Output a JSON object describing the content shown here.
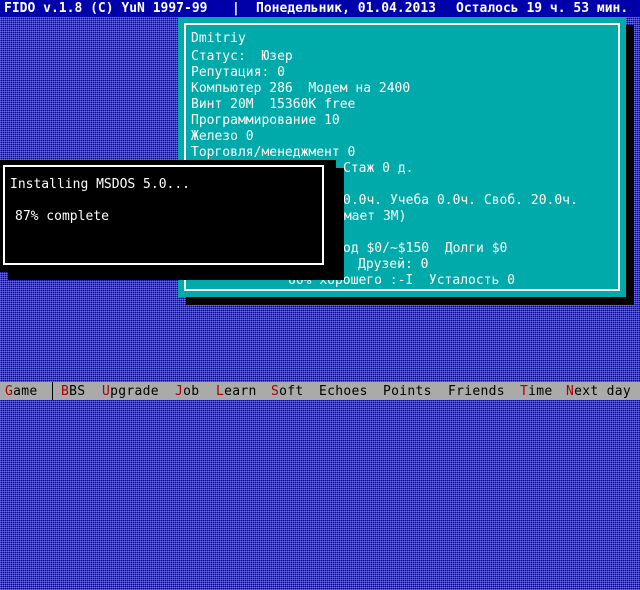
{
  "titlebar": {
    "app": "FIDO v.1.8 (C) YuN 1997-99",
    "separator": "|",
    "date": "Понедельник, 01.04.2013",
    "time_left": "Осталось 19 ч. 53 мин."
  },
  "player": {
    "name": "Dmitriy",
    "status_label": "Статус:",
    "status_value": "Юзер",
    "reputation_label": "Репутация:",
    "reputation_value": "0",
    "computer_label": "Компьютер",
    "computer_value": "286",
    "modem_label": "Модем на",
    "modem_value": "2400",
    "hdd_label": "Винт",
    "hdd_size": "20M",
    "hdd_free": "15360K free",
    "programming_label": "Программирование",
    "programming_value": "10",
    "hardware_label": "Железо",
    "hardware_value": "0",
    "trade_label": "Торговля/менеджмент",
    "trade_value": "0",
    "tenure_label": "Стаж",
    "tenure_value": "0 д.",
    "time_work": "0.0ч.",
    "study_label": "Учеба",
    "study_value": "0.0ч.",
    "free_label": "Своб.",
    "free_value": "20.0ч.",
    "occupies_fragment": "имает 3М)",
    "income_fragment": "од $0/~$150",
    "debts_label": "Долги",
    "debts_value": "$0",
    "friends_label": "Друзей:",
    "friends_value": "0",
    "mood_value": "60%",
    "mood_label": "хорошего :-I",
    "fatigue_label": "Усталость",
    "fatigue_value": "0"
  },
  "dialog": {
    "title": "Installing MSDOS 5.0...",
    "progress_text": "87% complete",
    "progress": 0.87
  },
  "menu": {
    "items": [
      {
        "hotkey": "G",
        "rest": "ame"
      },
      {
        "hotkey": "B",
        "rest": "BS"
      },
      {
        "hotkey": "U",
        "rest": "pgrade"
      },
      {
        "hotkey": "J",
        "rest": "ob"
      },
      {
        "hotkey": "L",
        "rest": "earn"
      },
      {
        "hotkey": "S",
        "rest": "oft"
      },
      {
        "hotkey": "E",
        "rest": "choes"
      },
      {
        "hotkey": "P",
        "rest": "oints"
      },
      {
        "hotkey": "F",
        "rest": "riends"
      },
      {
        "hotkey": "T",
        "rest": "ime"
      },
      {
        "hotkey": "N",
        "rest": "ext day"
      }
    ]
  },
  "colors": {
    "desktop": "#0000aa",
    "panel": "#00aaaa",
    "dialog": "#000000",
    "menubar": "#aaaaaa",
    "hotkey": "#aa0000"
  }
}
